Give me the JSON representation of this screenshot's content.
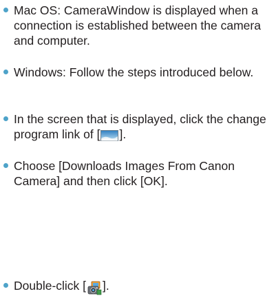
{
  "bullets": [
    {
      "text": "Mac OS: CameraWindow is displayed when a connection is established between the camera and computer."
    },
    {
      "text": "Windows: Follow the steps introduced below."
    },
    {
      "before": "In the screen that is displayed, click the change program link of [",
      "icon": "landscape-picture-icon",
      "after": "]."
    },
    {
      "text": "Choose [Downloads Images From Canon Camera] and then click [OK]."
    },
    {
      "before": "Double-click [",
      "icon": "camerawindow-app-icon",
      "after": "]."
    }
  ],
  "colors": {
    "bullet": "#4ea3c9",
    "text": "#231f20"
  }
}
